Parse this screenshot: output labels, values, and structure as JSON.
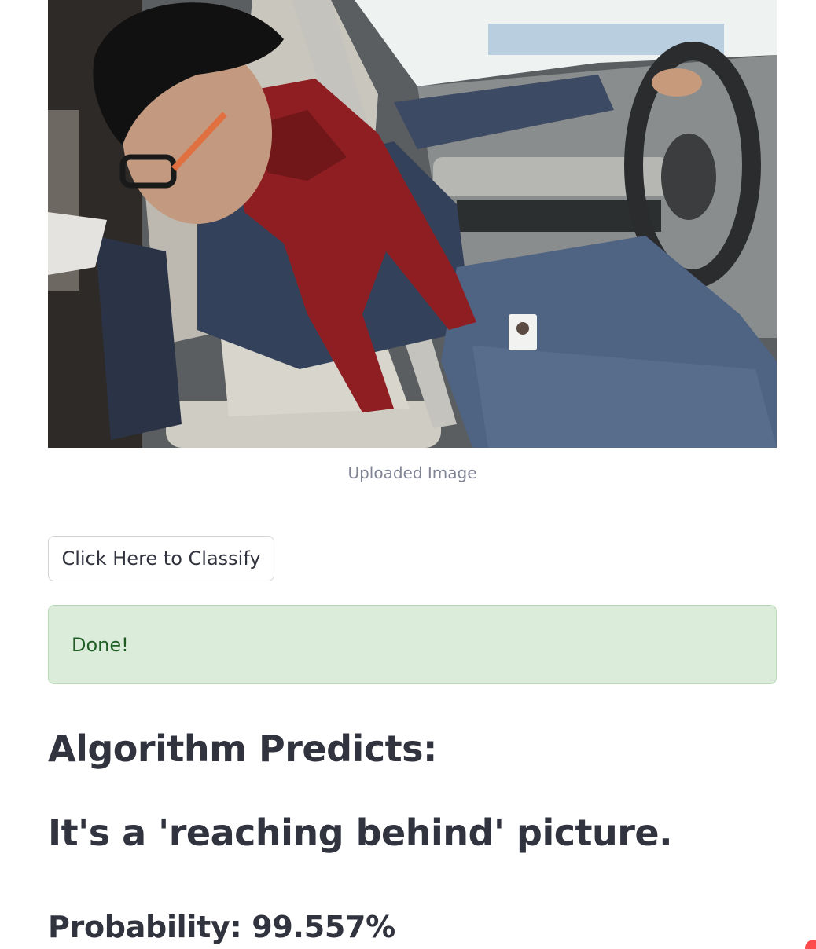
{
  "image": {
    "caption": "Uploaded Image",
    "subject": "driver-reaching-behind-photo"
  },
  "classify_button": {
    "label": "Click Here to Classify"
  },
  "status": {
    "message": "Done!",
    "color": "#1f5d25",
    "background": "#dcecda"
  },
  "results": {
    "heading": "Algorithm Predicts:",
    "prediction": "It's a 'reaching behind' picture.",
    "probability": "Probability: 99.557%"
  },
  "colors": {
    "text": "#31333f",
    "caption": "#808495",
    "accent": "#ff4b4b"
  }
}
